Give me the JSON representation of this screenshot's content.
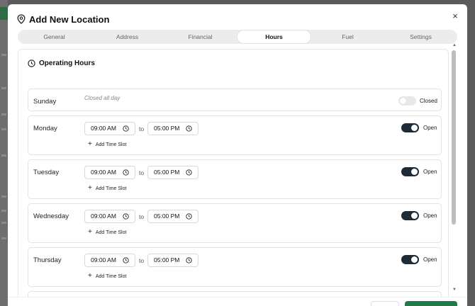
{
  "dialog": {
    "title": "Add New Location",
    "close_glyph": "×"
  },
  "tabs": [
    {
      "label": "General",
      "active": false
    },
    {
      "label": "Address",
      "active": false
    },
    {
      "label": "Financial",
      "active": false
    },
    {
      "label": "Hours",
      "active": true
    },
    {
      "label": "Fuel",
      "active": false
    },
    {
      "label": "Settings",
      "active": false
    }
  ],
  "section": {
    "title": "Operating Hours"
  },
  "days": [
    {
      "name": "Sunday",
      "open": false,
      "note": "Closed all day",
      "status": "Closed"
    },
    {
      "name": "Monday",
      "open": true,
      "from": "09:00 AM",
      "to": "05:00 PM",
      "to_label": "to",
      "add_slot": "Add Time Slot",
      "status": "Open"
    },
    {
      "name": "Tuesday",
      "open": true,
      "from": "09:00 AM",
      "to": "05:00 PM",
      "to_label": "to",
      "add_slot": "Add Time Slot",
      "status": "Open"
    },
    {
      "name": "Wednesday",
      "open": true,
      "from": "09:00 AM",
      "to": "05:00 PM",
      "to_label": "to",
      "add_slot": "Add Time Slot",
      "status": "Open"
    },
    {
      "name": "Thursday",
      "open": true,
      "from": "09:00 AM",
      "to": "05:00 PM",
      "to_label": "to",
      "add_slot": "Add Time Slot",
      "status": "Open"
    }
  ],
  "colors": {
    "toggle_on": "#1f2a37",
    "toggle_off": "#e8e8e8",
    "primary": "#1f7a4a"
  },
  "icons": {
    "title": "map-pin-icon",
    "section": "clock-icon",
    "time": "clock-icon",
    "close": "close-icon",
    "add": "plus-icon"
  }
}
